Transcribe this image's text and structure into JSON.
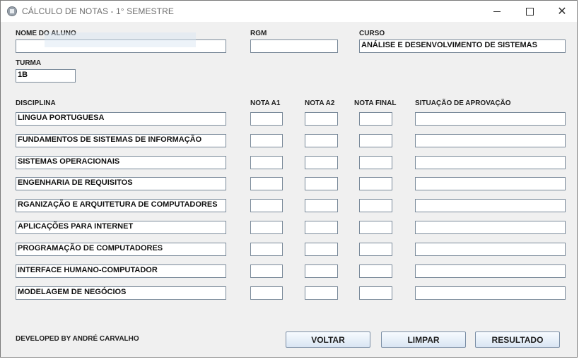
{
  "window": {
    "title": "CÁLCULO DE NOTAS - 1° SEMESTRE"
  },
  "labels": {
    "nome": "NOME DO ALUNO",
    "rgm": "RGM",
    "curso": "CURSO",
    "turma": "TURMA",
    "disciplina": "DISCIPLINA",
    "nota_a1": "NOTA A1",
    "nota_a2": "NOTA A2",
    "nota_final": "NOTA FINAL",
    "situacao": "SITUAÇÃO DE APROVAÇÃO"
  },
  "fields": {
    "nome": "",
    "rgm": "",
    "curso": "ANÁLISE E DESENVOLVIMENTO DE SISTEMAS",
    "turma": "1B"
  },
  "disciplinas": [
    "LINGUA PORTUGUESA",
    "FUNDAMENTOS DE SISTEMAS DE INFORMAÇÃO",
    "SISTEMAS OPERACIONAIS",
    "ENGENHARIA DE REQUISITOS",
    "RGANIZAÇÃO E ARQUITETURA DE COMPUTADORES",
    "APLICAÇÕES PARA INTERNET",
    "PROGRAMAÇÃO DE COMPUTADORES",
    "INTERFACE HUMANO-COMPUTADOR",
    "MODELAGEM DE NEGÓCIOS"
  ],
  "footer": "DEVELOPED BY ANDRÉ CARVALHO",
  "buttons": {
    "voltar": "VOLTAR",
    "limpar": "LIMPAR",
    "resultado": "RESULTADO"
  },
  "icons": {
    "app": "app-window-icon",
    "minimize": "minimize-icon",
    "maximize": "maximize-icon",
    "close": "close-icon"
  }
}
